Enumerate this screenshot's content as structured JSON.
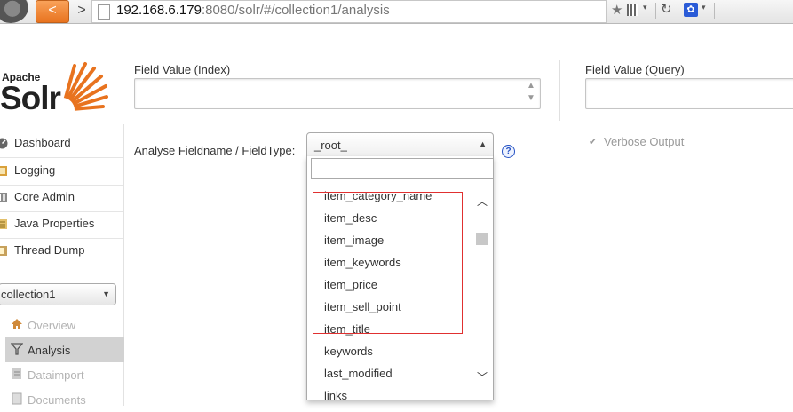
{
  "browser": {
    "url_host": "192.168.6.179",
    "url_rest": ":8080/solr/#/collection1/analysis",
    "back_glyph": "<",
    "forward_glyph": ">",
    "star_glyph": "★",
    "reload_glyph": "↻",
    "paw_glyph": "✿",
    "dropdown_glyph": "▾"
  },
  "logo": {
    "apache": "Apache",
    "solr": "Solr",
    "sun_color": "#e8731f"
  },
  "sidebar": {
    "nav": [
      {
        "label": "Dashboard",
        "icon": "dashboard-icon"
      },
      {
        "label": "Logging",
        "icon": "logging-icon"
      },
      {
        "label": "Core Admin",
        "icon": "core-admin-icon"
      },
      {
        "label": "Java Properties",
        "icon": "java-properties-icon"
      },
      {
        "label": "Thread Dump",
        "icon": "thread-dump-icon"
      }
    ],
    "core_selector": {
      "value": "collection1",
      "arrow": "▼"
    },
    "core_menu": [
      {
        "label": "Overview",
        "icon": "overview-icon",
        "state": "dim"
      },
      {
        "label": "Analysis",
        "icon": "analysis-icon",
        "state": "active"
      },
      {
        "label": "Dataimport",
        "icon": "dataimport-icon",
        "state": "dim"
      },
      {
        "label": "Documents",
        "icon": "documents-icon",
        "state": "dim"
      }
    ]
  },
  "form": {
    "field_value_index_label": "Field Value (Index)",
    "field_value_query_label": "Field Value (Query)",
    "fieldname_label": "Analyse Fieldname / FieldType:",
    "selected_fieldtype": "_root_",
    "select_arrow": "▲",
    "help_glyph": "?",
    "verbose_label": "Verbose Output",
    "verbose_glyph": "✔"
  },
  "dropdown": {
    "search_value": "",
    "search_glyph": "🔍",
    "options": [
      "item_category_name",
      "item_desc",
      "item_image",
      "item_keywords",
      "item_price",
      "item_sell_point",
      "item_title",
      "keywords",
      "last_modified",
      "links"
    ],
    "scroll_up_glyph": "︿",
    "scroll_down_glyph": "﹀",
    "highlight_color": "#e03030"
  }
}
